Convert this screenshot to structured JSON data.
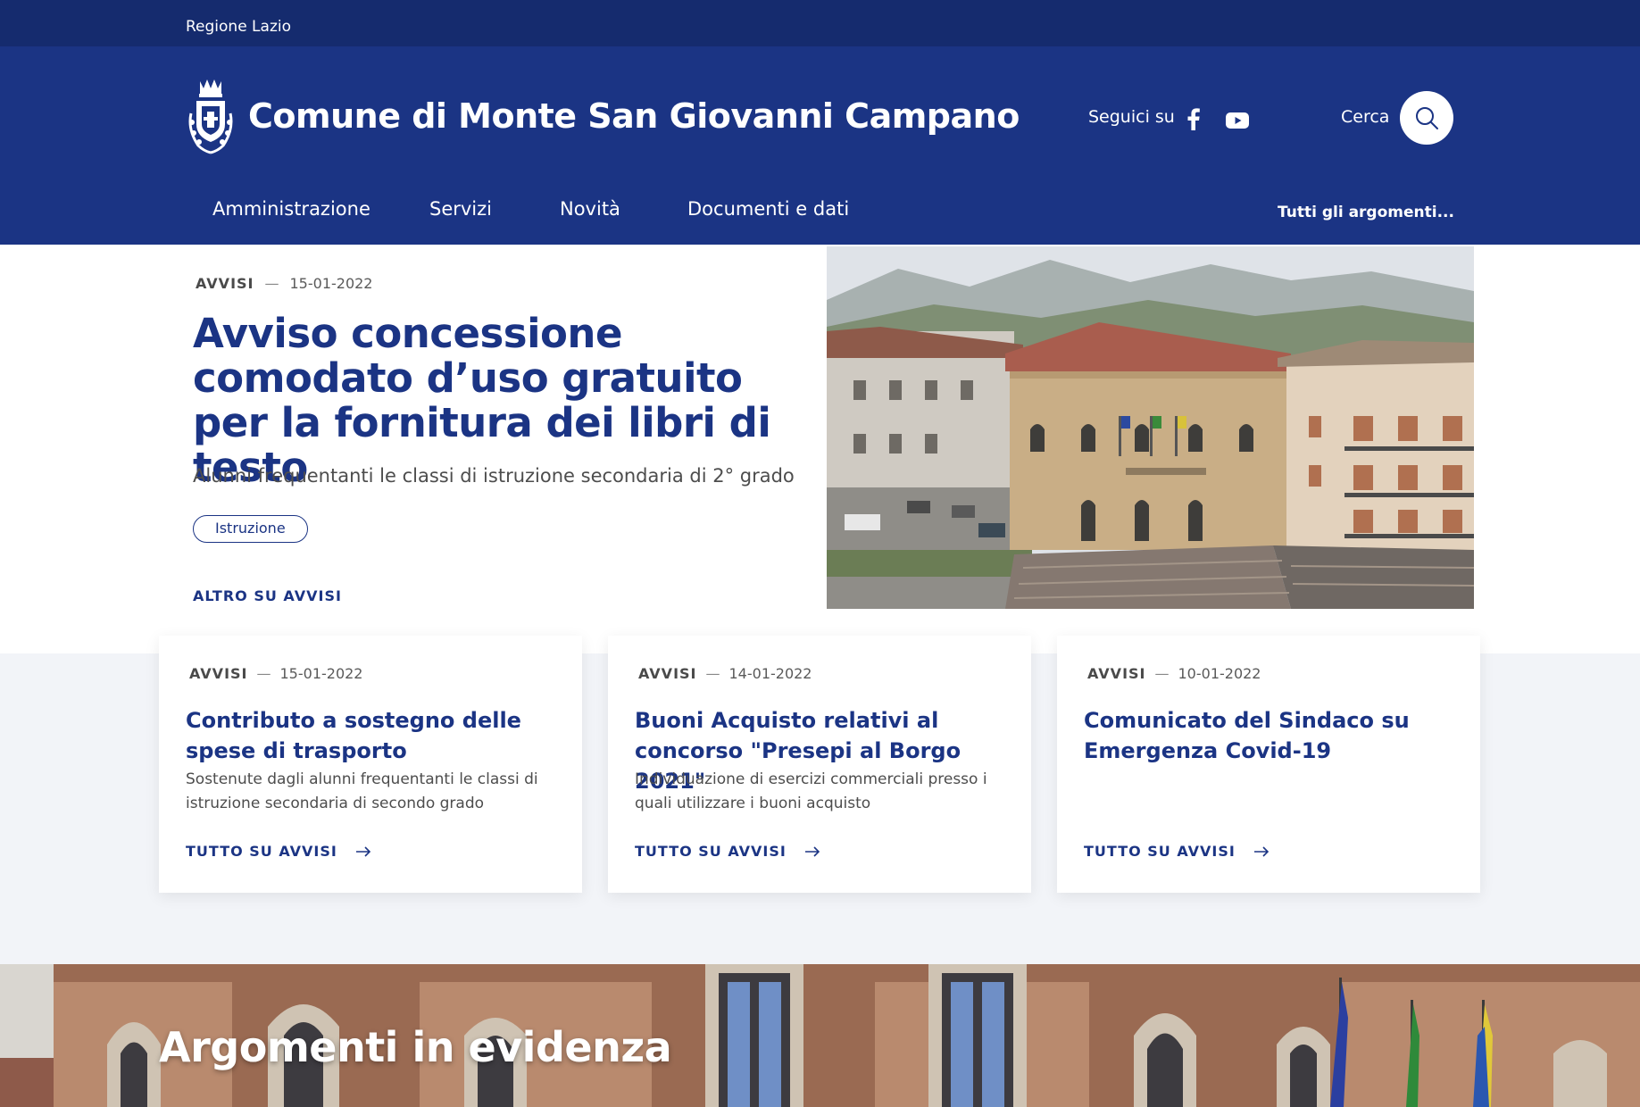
{
  "topbar": {
    "region": "Regione Lazio"
  },
  "header": {
    "site_title": "Comune di Monte San Giovanni Campano",
    "follow_label": "Seguici su",
    "social": [
      "facebook-icon",
      "youtube-icon"
    ],
    "search_label": "Cerca",
    "colors": {
      "primary": "#1b3484",
      "topbar": "#152b6e"
    }
  },
  "nav": {
    "items": [
      "Amministrazione",
      "Servizi",
      "Novità",
      "Documenti e dati"
    ],
    "all_topics": "Tutti gli argomenti..."
  },
  "hero": {
    "category": "AVVISI",
    "dash": "—",
    "date": "15-01-2022",
    "title": "Avviso concessione comodato d’uso gratuito per la fornitura dei libri di testo",
    "subtitle": "Alunni frequentanti le classi di istruzione secondaria di 2° grado",
    "tag": "Istruzione",
    "more_link": "ALTRO SU AVVISI"
  },
  "cards": [
    {
      "category": "AVVISI",
      "dash": "—",
      "date": "15-01-2022",
      "title": "Contributo a sostegno delle spese di trasporto",
      "description": "Sostenute dagli alunni frequentanti le classi di istruzione secondaria di secondo grado",
      "link": "TUTTO SU AVVISI"
    },
    {
      "category": "AVVISI",
      "dash": "—",
      "date": "14-01-2022",
      "title": "Buoni Acquisto relativi al concorso \"Presepi al Borgo 2021\"",
      "description": "Individuazione di esercizi commerciali presso i quali utilizzare i buoni acquisto",
      "link": "TUTTO SU AVVISI"
    },
    {
      "category": "AVVISI",
      "dash": "—",
      "date": "10-01-2022",
      "title": "Comunicato del Sindaco su Emergenza Covid-19",
      "description": "",
      "link": "TUTTO SU AVVISI"
    }
  ],
  "evidenza": {
    "title": "Argomenti in evidenza"
  }
}
